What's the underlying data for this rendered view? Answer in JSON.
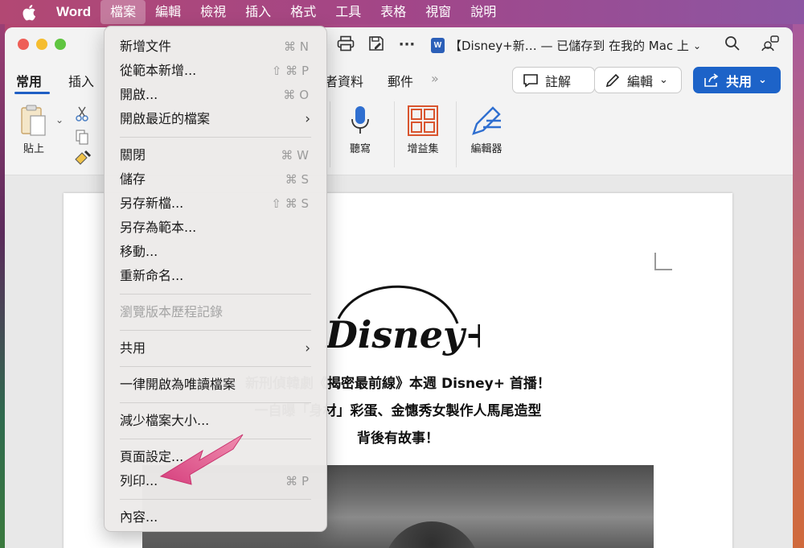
{
  "menubar": {
    "app": "Word",
    "items": [
      "檔案",
      "編輯",
      "檢視",
      "插入",
      "格式",
      "工具",
      "表格",
      "視窗",
      "說明"
    ],
    "active_index": 0
  },
  "titlebar": {
    "doc_title": "【Disney+新… — 已儲存到 在我的 Mac 上",
    "word_badge": "W"
  },
  "ribbon": {
    "tabs": [
      "常用",
      "插入",
      "者資料",
      "郵件"
    ],
    "active_tab": "常用",
    "more": "»",
    "comment_label": "註解",
    "edit_label": "編輯",
    "share_label": "共用",
    "paste_label": "貼上",
    "dictate_label": "聽寫",
    "addins_label": "增益集",
    "editor_label": "編輯器"
  },
  "document": {
    "logo_text": "Disney+",
    "headline_lines": [
      "新刑偵韓劇《揭密最前線》本週 Disney+ 首播！",
      "一自曝「身材」彩蛋、金憓秀女製作人馬尾造型",
      "背後有故事！"
    ]
  },
  "file_menu": {
    "sections": [
      [
        {
          "label": "新增文件",
          "shortcut": "⌘ N"
        },
        {
          "label": "從範本新增...",
          "shortcut": "⇧ ⌘ P"
        },
        {
          "label": "開啟...",
          "shortcut": "⌘ O"
        },
        {
          "label": "開啟最近的檔案",
          "shortcut": "",
          "submenu": true
        }
      ],
      [
        {
          "label": "關閉",
          "shortcut": "⌘ W"
        },
        {
          "label": "儲存",
          "shortcut": "⌘ S"
        },
        {
          "label": "另存新檔...",
          "shortcut": "⇧ ⌘ S"
        },
        {
          "label": "另存為範本...",
          "shortcut": ""
        },
        {
          "label": "移動...",
          "shortcut": ""
        },
        {
          "label": "重新命名...",
          "shortcut": ""
        }
      ],
      [
        {
          "label": "瀏覽版本歷程記錄",
          "shortcut": "",
          "disabled": true
        }
      ],
      [
        {
          "label": "共用",
          "shortcut": "",
          "submenu": true
        }
      ],
      [
        {
          "label": "一律開啟為唯讀檔案",
          "shortcut": ""
        }
      ],
      [
        {
          "label": "減少檔案大小...",
          "shortcut": ""
        }
      ],
      [
        {
          "label": "頁面設定...",
          "shortcut": ""
        },
        {
          "label": "列印...",
          "shortcut": "⌘ P"
        }
      ],
      [
        {
          "label": "內容...",
          "shortcut": ""
        }
      ]
    ]
  },
  "colors": {
    "accent_blue": "#1d63c8",
    "arrow_pink": "#d6407e",
    "menubar_bg": "#b24873"
  }
}
